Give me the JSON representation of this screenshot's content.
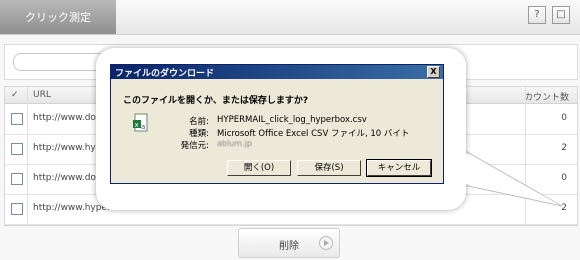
{
  "header": {
    "tab_label": "クリック測定",
    "help_icon": "?",
    "window_icon": "□"
  },
  "table": {
    "headers": {
      "check": "✓",
      "url": "URL",
      "count": "カウント数"
    },
    "rows": [
      {
        "url": "http://www.doma",
        "count": "0"
      },
      {
        "url": "http://www.hype",
        "count": "2"
      },
      {
        "url": "http://www.doma",
        "count": "0"
      },
      {
        "url": "http://www.hyper",
        "count": "2"
      }
    ]
  },
  "footer": {
    "delete_label": "削除"
  },
  "dialog": {
    "title": "ファイルのダウンロード",
    "close_label": "X",
    "question": "このファイルを開くか、または保存しますか?",
    "name_label": "名前:",
    "name_value": "HYPERMAIL_click_log_hyperbox.csv",
    "type_label": "種類:",
    "type_value": "Microsoft Office Excel CSV ファイル, 10 バイト",
    "from_label": "発信元:",
    "from_value": "ablum.jp",
    "open_label": "開く(O)",
    "save_label": "保存(S)",
    "cancel_label": "キャンセル"
  },
  "colors": {
    "titlebar": "#0a246a",
    "dialog_bg": "#ece9d8",
    "tab_bg": "#9a9a9a"
  }
}
